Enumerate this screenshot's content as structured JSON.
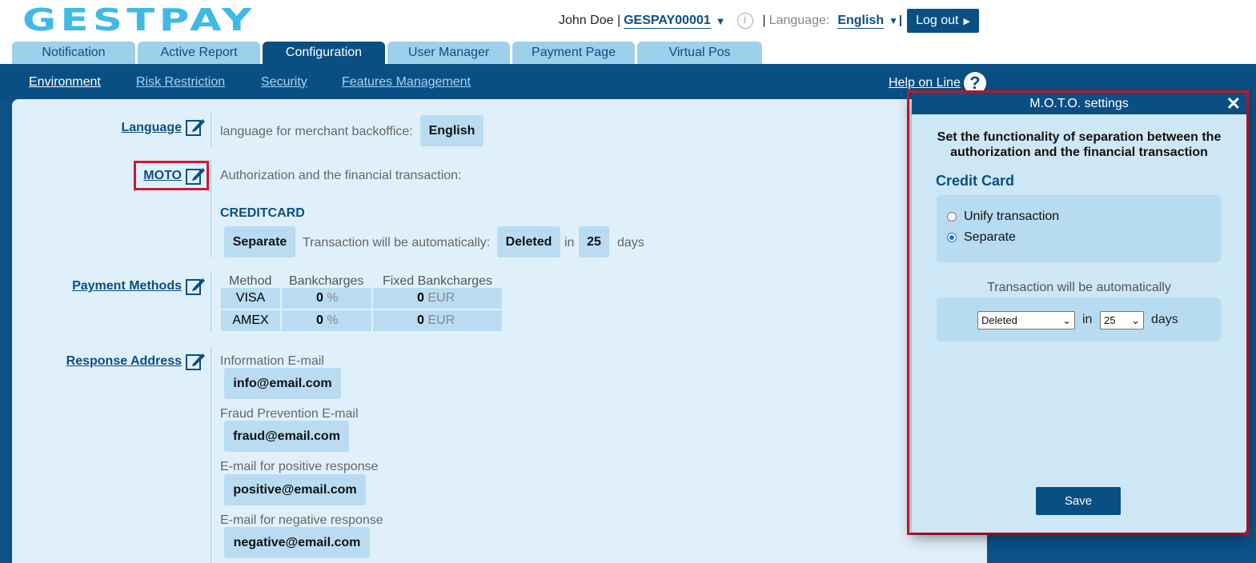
{
  "header": {
    "logo_text": "GESTPAY",
    "user_name": "John Doe",
    "account": "GESPAY00001",
    "language_label": "Language:",
    "language_value": "English",
    "logout_label": "Log out"
  },
  "tabs": [
    {
      "label": "Notification",
      "active": false
    },
    {
      "label": "Active Report",
      "active": false
    },
    {
      "label": "Configuration",
      "active": true
    },
    {
      "label": "User Manager",
      "active": false
    },
    {
      "label": "Payment Page",
      "active": false
    },
    {
      "label": "Virtual Pos",
      "active": false
    }
  ],
  "subnav": [
    {
      "label": "Environment",
      "active": true
    },
    {
      "label": "Risk Restriction",
      "active": false
    },
    {
      "label": "Security",
      "active": false
    },
    {
      "label": "Features Management",
      "active": false
    }
  ],
  "help_label": "Help on Line",
  "config": {
    "language": {
      "label": "Language",
      "description": "language for merchant backoffice:",
      "value": "English"
    },
    "moto": {
      "label": "MOTO",
      "description": "Authorization and the financial transaction:",
      "section": "CREDITCARD",
      "mode": "Separate",
      "auto_text": "Transaction will be automatically:",
      "action": "Deleted",
      "in_text": "in",
      "days_value": "25",
      "days_text": "days"
    },
    "payment_methods": {
      "label": "Payment Methods",
      "headers": [
        "Method",
        "Bankcharges",
        "Fixed Bankcharges"
      ],
      "rows": [
        {
          "method": "VISA",
          "bank": "0",
          "bank_unit": "%",
          "fixed": "0",
          "fixed_unit": "EUR"
        },
        {
          "method": "AMEX",
          "bank": "0",
          "bank_unit": "%",
          "fixed": "0",
          "fixed_unit": "EUR"
        }
      ]
    },
    "response_address": {
      "label": "Response Address",
      "items": [
        {
          "label": "Information E-mail",
          "value": "info@email.com"
        },
        {
          "label": "Fraud Prevention E-mail",
          "value": "fraud@email.com"
        },
        {
          "label": "E-mail for positive response",
          "value": "positive@email.com"
        },
        {
          "label": "E-mail for negative response",
          "value": "negative@email.com"
        }
      ]
    }
  },
  "modal": {
    "title": "M.O.T.O. settings",
    "heading_line1": "Set the functionality of separation between the",
    "heading_line2": "authorization and the financial transaction",
    "section": "Credit Card",
    "options": [
      {
        "label": "Unify transaction",
        "selected": false
      },
      {
        "label": "Separate",
        "selected": true
      }
    ],
    "auto_text": "Transaction will be automatically",
    "action_select": "Deleted",
    "in_text": "in",
    "days_select": "25",
    "days_text": "days",
    "save_label": "Save"
  },
  "colors": {
    "brand": "#0a4f84",
    "logo": "#3fb9e6",
    "tab": "#9dd0ea",
    "panel": "#e0f0fa",
    "highlight_box": "#d0192b"
  }
}
